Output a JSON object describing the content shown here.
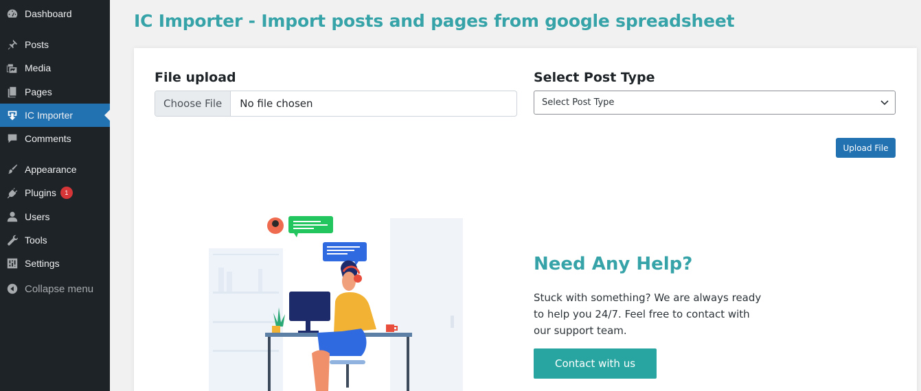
{
  "sidebar": {
    "items": [
      {
        "label": "Dashboard",
        "icon": "dashboard-icon"
      },
      {
        "label": "Posts",
        "icon": "pin-icon"
      },
      {
        "label": "Media",
        "icon": "media-icon"
      },
      {
        "label": "Pages",
        "icon": "pages-icon"
      },
      {
        "label": "IC Importer",
        "icon": "import-icon",
        "active": true
      },
      {
        "label": "Comments",
        "icon": "comment-icon"
      },
      {
        "label": "Appearance",
        "icon": "brush-icon"
      },
      {
        "label": "Plugins",
        "icon": "plugin-icon",
        "badge": "1"
      },
      {
        "label": "Users",
        "icon": "user-icon"
      },
      {
        "label": "Tools",
        "icon": "wrench-icon"
      },
      {
        "label": "Settings",
        "icon": "settings-icon"
      },
      {
        "label": "Collapse menu",
        "icon": "collapse-icon"
      }
    ]
  },
  "page": {
    "title": "IC Importer - Import posts and pages from google spreadsheet"
  },
  "form": {
    "file_label": "File upload",
    "choose_file": "Choose File",
    "no_file": "No file chosen",
    "post_type_label": "Select Post Type",
    "post_type_selected": "Select Post Type",
    "upload_button": "Upload File"
  },
  "help": {
    "title": "Need Any Help?",
    "text": "Stuck with something? We are always ready to help you 24/7. Feel free to contact with our support team.",
    "button": "Contact with us"
  },
  "colors": {
    "accent": "#36a3a8",
    "primary": "#2271b1",
    "sidebar": "#1d2327",
    "badge": "#d63638"
  }
}
